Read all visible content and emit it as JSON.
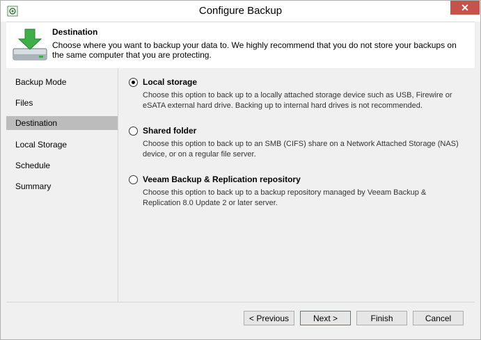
{
  "window": {
    "title": "Configure Backup",
    "close_glyph": "✕"
  },
  "header": {
    "title": "Destination",
    "description": "Choose where you want to backup your data to. We highly recommend that you do not store your backups on the same computer that you are protecting."
  },
  "sidebar": {
    "items": [
      {
        "label": "Backup Mode"
      },
      {
        "label": "Files"
      },
      {
        "label": "Destination",
        "active": true
      },
      {
        "label": "Local Storage"
      },
      {
        "label": "Schedule"
      },
      {
        "label": "Summary"
      }
    ]
  },
  "options": [
    {
      "label": "Local storage",
      "checked": true,
      "description": "Choose this option to back up to a locally attached storage device such as USB, Firewire or eSATA external hard drive. Backing up to internal hard drives is not recommended."
    },
    {
      "label": "Shared folder",
      "checked": false,
      "description": "Choose this option to back up to an SMB (CIFS) share on a Network Attached Storage (NAS) device, or on a regular file server."
    },
    {
      "label": "Veeam Backup & Replication repository",
      "checked": false,
      "description": "Choose this option to back up to a backup repository managed by Veeam Backup & Replication 8.0 Update 2 or later server."
    }
  ],
  "buttons": {
    "previous": "< Previous",
    "next": "Next >",
    "finish": "Finish",
    "cancel": "Cancel"
  },
  "colors": {
    "close": "#c7514b",
    "active_nav": "#bcbcbc",
    "accent_green": "#3fae49"
  }
}
